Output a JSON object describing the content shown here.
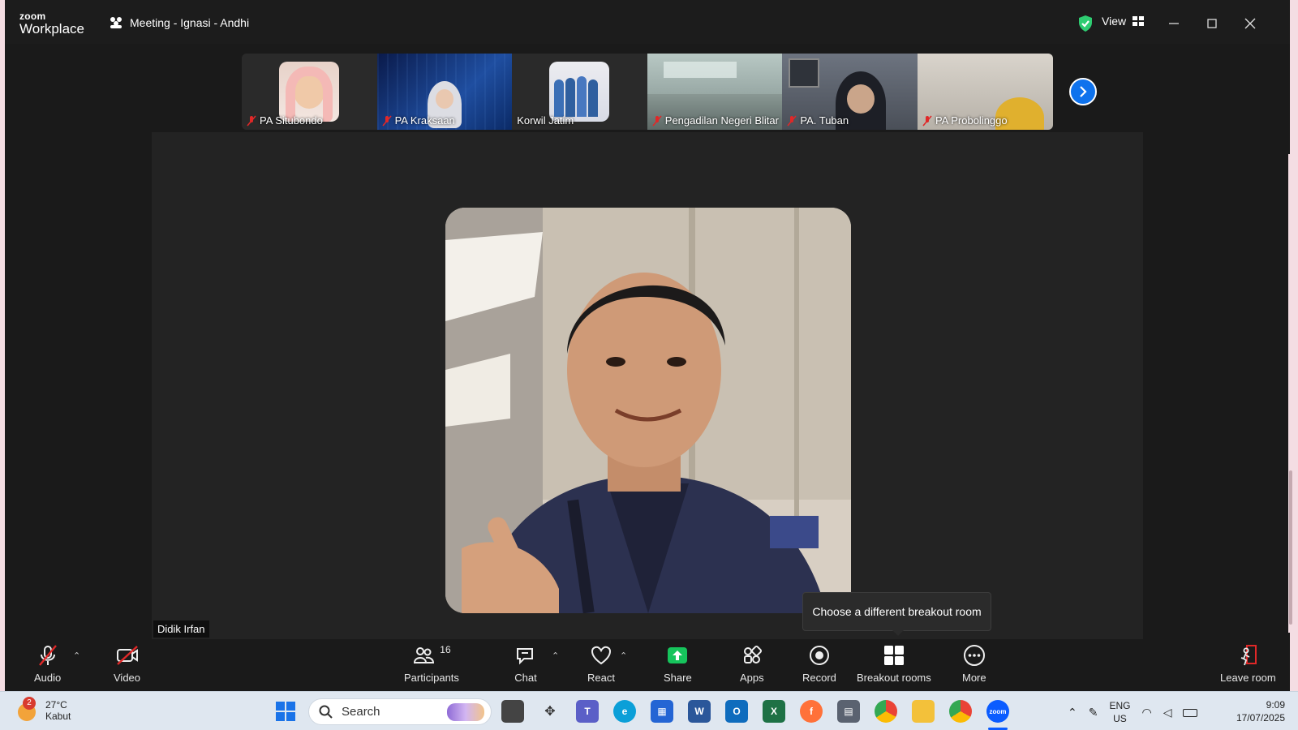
{
  "window": {
    "logo_top": "zoom",
    "logo_bottom": "Workplace",
    "meeting_title": "Meeting - Ignasi - Andhi",
    "view_label": "View"
  },
  "thumbnails": [
    {
      "label": "PA Situbondo",
      "muted": true
    },
    {
      "label": "PA Kraksaan",
      "muted": true
    },
    {
      "label": "Korwil Jatim",
      "muted": false
    },
    {
      "label": "Pengadilan Negeri Blitar",
      "muted": true
    },
    {
      "label": "PA. Tuban",
      "muted": true
    },
    {
      "label": "PA Probolinggo",
      "muted": true
    }
  ],
  "stage": {
    "speaker_name": "Didik Irfan",
    "tooltip": "Choose a different breakout room"
  },
  "toolbar": {
    "audio": "Audio",
    "video": "Video",
    "participants": "Participants",
    "participants_count": "16",
    "chat": "Chat",
    "react": "React",
    "share": "Share",
    "apps": "Apps",
    "record": "Record",
    "breakout": "Breakout rooms",
    "more": "More",
    "leave": "Leave room"
  },
  "taskbar": {
    "weather_badge": "2",
    "temperature": "27°C",
    "condition": "Kabut",
    "search_label": "Search",
    "lang_top": "ENG",
    "lang_bottom": "US",
    "time": "9:09",
    "date": "17/07/2025"
  },
  "colors": {
    "accent": "#0e72ed",
    "share_green": "#16c45c",
    "muted_red": "#e02828",
    "shield_green": "#2ecc71"
  }
}
